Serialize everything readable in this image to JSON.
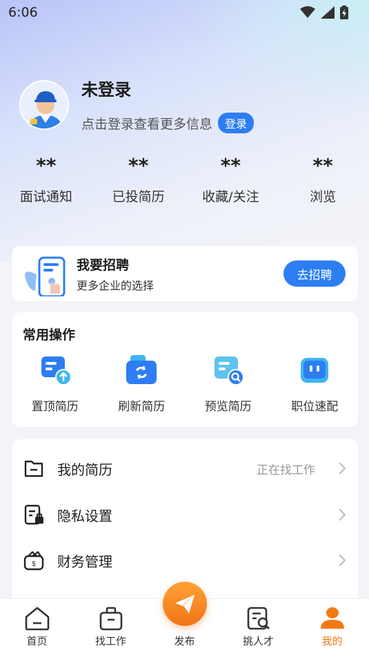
{
  "status_bar": {
    "time": "6:06"
  },
  "profile": {
    "name": "未登录",
    "hint": "点击登录查看更多信息",
    "login_label": "登录"
  },
  "stats": [
    {
      "value": "**",
      "label": "面试通知"
    },
    {
      "value": "**",
      "label": "已投简历"
    },
    {
      "value": "**",
      "label": "收藏/关注"
    },
    {
      "value": "**",
      "label": "浏览"
    }
  ],
  "recruit": {
    "title": "我要招聘",
    "subtitle": "更多企业的选择",
    "button": "去招聘"
  },
  "ops": {
    "title": "常用操作",
    "items": [
      {
        "label": "置顶简历",
        "icon": "resume-top-icon"
      },
      {
        "label": "刷新简历",
        "icon": "refresh-resume-icon"
      },
      {
        "label": "预览简历",
        "icon": "preview-resume-icon"
      },
      {
        "label": "职位速配",
        "icon": "job-match-icon"
      }
    ]
  },
  "menu": [
    {
      "label": "我的简历",
      "value": "正在找工作",
      "icon": "folder-icon"
    },
    {
      "label": "隐私设置",
      "value": "",
      "icon": "privacy-lock-icon"
    },
    {
      "label": "财务管理",
      "value": "",
      "icon": "wallet-icon"
    }
  ],
  "tabbar": [
    {
      "label": "首页",
      "icon": "home-icon"
    },
    {
      "label": "找工作",
      "icon": "briefcase-icon"
    },
    {
      "label": "发布",
      "icon": "paper-plane-icon"
    },
    {
      "label": "挑人才",
      "icon": "search-resume-icon"
    },
    {
      "label": "我的",
      "icon": "user-icon",
      "active": true
    }
  ],
  "colors": {
    "primary_blue": "#2d7ef2",
    "accent_orange": "#f07b16"
  }
}
